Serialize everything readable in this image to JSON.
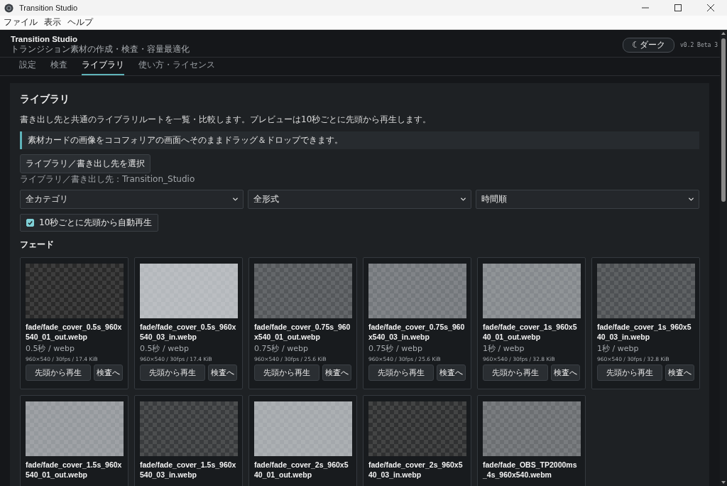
{
  "window": {
    "title": "Transition Studio"
  },
  "menu": [
    "ファイル",
    "表示",
    "ヘルプ"
  ],
  "header": {
    "title": "Transition Studio",
    "subtitle": "トランジション素材の作成・検査・容量最適化",
    "theme_button": "☾ダーク",
    "version": "v0.2 Beta 3"
  },
  "tabs": [
    {
      "label": "設定",
      "selected": false
    },
    {
      "label": "検査",
      "selected": false
    },
    {
      "label": "ライブラリ",
      "selected": true
    },
    {
      "label": "使い方・ライセンス",
      "selected": false
    }
  ],
  "library": {
    "heading": "ライブラリ",
    "description": "書き出し先と共通のライブラリルートを一覧・比較します。プレビューは10秒ごとに先頭から再生します。",
    "note": "素材カードの画像をココフォリアの画面へそのままドラッグ＆ドロップできます。",
    "select_button": "ライブラリ／書き出し先を選択",
    "path": "ライブラリ／書き出し先：Transition_Studio",
    "filters": [
      {
        "value": "全カテゴリ"
      },
      {
        "value": "全形式"
      },
      {
        "value": "時間順"
      }
    ],
    "autoplay": {
      "label": "10秒ごとに先頭から自動再生",
      "checked": true
    },
    "section": "フェード",
    "cards": [
      {
        "name": "fade/fade_cover_0.5s_960x540_01_out.webp",
        "color": "#2a2a2a",
        "meta": "0.5秒 / webp",
        "details": "960×540 / 30fps / 17.4 KiB",
        "buttons": [
          "先頭から再生",
          "検査へ"
        ]
      },
      {
        "name": "fade/fade_cover_0.5s_960x540_03_in.webp",
        "color": "#b4b8bc",
        "meta": "0.5秒 / webp",
        "details": "960×540 / 30fps / 17.4 KiB",
        "buttons": [
          "先頭から再生",
          "検査へ"
        ]
      },
      {
        "name": "fade/fade_cover_0.75s_960x540_01_out.webp",
        "color": "#55585b",
        "meta": "0.75秒 / webp",
        "details": "960×540 / 30fps / 25.6 KiB",
        "buttons": [
          "先頭から再生",
          "検査へ"
        ]
      },
      {
        "name": "fade/fade_cover_0.75s_960x540_03_in.webp",
        "color": "#74787c",
        "meta": "0.75秒 / webp",
        "details": "960×540 / 30fps / 25.6 KiB",
        "buttons": [
          "先頭から再生",
          "検査へ"
        ]
      },
      {
        "name": "fade/fade_cover_1s_960x540_01_out.webp",
        "color": "#85898d",
        "meta": "1秒 / webp",
        "details": "960×540 / 30fps / 32.8 KiB",
        "buttons": [
          "先頭から再生",
          "検査へ"
        ]
      },
      {
        "name": "fade/fade_cover_1s_960x540_03_in.webp",
        "color": "#4e5154",
        "meta": "1秒 / webp",
        "details": "960×540 / 30fps / 32.8 KiB",
        "buttons": [
          "先頭から再生",
          "検査へ"
        ]
      },
      {
        "name": "fade/fade_cover_1.5s_960x540_01_out.webp",
        "color": "#95999d"
      },
      {
        "name": "fade/fade_cover_1.5s_960x540_03_in.webp",
        "color": "#3a3c3e"
      },
      {
        "name": "fade/fade_cover_2s_960x540_01_out.webp",
        "color": "#a4a8ac"
      },
      {
        "name": "fade/fade_cover_2s_960x540_03_in.webp",
        "color": "#303132"
      },
      {
        "name": "fade/fade_OBS_TP2000ms_4s_960x540.webm",
        "color": "#6c6f72"
      }
    ]
  }
}
